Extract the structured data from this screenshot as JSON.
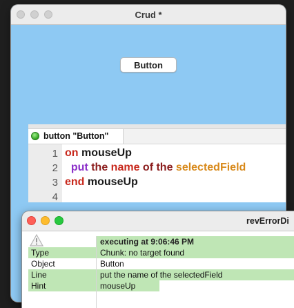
{
  "main_window": {
    "title": "Crud *",
    "button_label": "Button"
  },
  "script_editor": {
    "tab_label": "button \"Button\"",
    "line_numbers": [
      "1",
      "2",
      "3",
      "4"
    ],
    "code": {
      "l1_kw": "on",
      "l1_name": " mouseUp",
      "l2_indent": "  ",
      "l2_put": "put",
      "l2_the1": " the",
      "l2_name": " name",
      "l2_of": " of",
      "l2_the2": " the",
      "l2_field": " selectedField",
      "l3_kw": "end",
      "l3_name": " mouseUp"
    }
  },
  "error_window": {
    "title": "revErrorDi",
    "header": "executing at 9:06:46 PM",
    "rows": [
      {
        "key": "Type",
        "value": "Chunk: no target found"
      },
      {
        "key": "Object",
        "value": "Button"
      },
      {
        "key": "Line",
        "value": "put the name of the selectedField"
      },
      {
        "key": "Hint",
        "value": "mouseUp"
      }
    ]
  },
  "icons": {
    "warning": "warning-triangle-icon",
    "tab_status": "green-dot-icon"
  },
  "colors": {
    "stack_background": "#8ec9f3",
    "error_highlight": "#bfe6b5",
    "keyword_red": "#c8291d",
    "keyword_purple": "#8b2fc9",
    "property_orange": "#d8891a"
  }
}
